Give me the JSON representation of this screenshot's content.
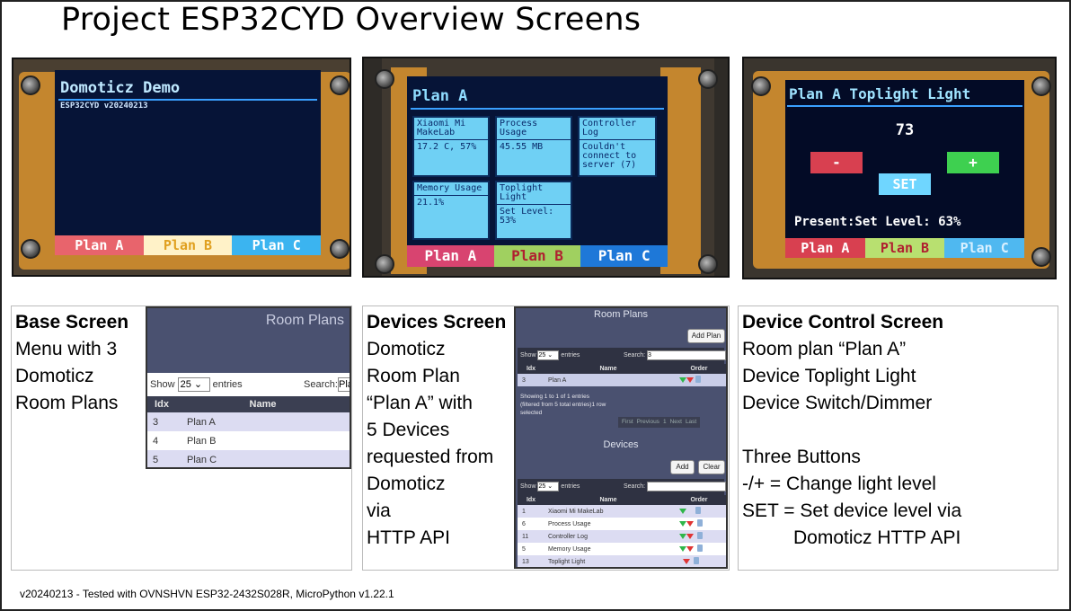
{
  "title": "Project ESP32CYD Overview Screens",
  "photos": {
    "base": {
      "title": "Domoticz Demo",
      "version": "ESP32CYD v20240213",
      "menu": [
        "Plan A",
        "Plan B",
        "Plan C"
      ]
    },
    "devices": {
      "title": "Plan A",
      "tiles": [
        {
          "name": "Xiaomi Mi MakeLab",
          "value": "17.2 C, 57%"
        },
        {
          "name": "Process Usage",
          "value": "45.55 MB"
        },
        {
          "name": "Controller Log",
          "value": "Couldn't connect to server (7)"
        },
        {
          "name": "Memory Usage",
          "value": "21.1%"
        },
        {
          "name": "Toplight Light",
          "value": "Set Level: 53%"
        }
      ],
      "menu": [
        "Plan A",
        "Plan B",
        "Plan C"
      ]
    },
    "control": {
      "title": "Plan A Toplight Light",
      "value": "73",
      "minus": "-",
      "plus": "+",
      "set": "SET",
      "present": "Present:Set Level: 63%",
      "menu": [
        "Plan A",
        "Plan B",
        "Plan C"
      ]
    }
  },
  "colors": {
    "menu_a": "#e8646c",
    "menu_b": "#b8e070",
    "menu_c": "#3bb4f0",
    "lcd_bg": "#061437",
    "tile_bg": "#6fd0f4"
  },
  "base_panel": {
    "heading": "Base Screen",
    "lines": [
      "Menu with 3",
      "Domoticz",
      "Room Plans"
    ]
  },
  "devices_panel": {
    "heading": "Devices Screen",
    "lines": [
      "Domoticz",
      "Room Plan",
      "“Plan A” with",
      "5 Devices",
      "requested from",
      "Domoticz",
      "via",
      "HTTP API"
    ]
  },
  "control_panel": {
    "heading": "Device Control Screen",
    "lines": [
      "Room plan “Plan A”",
      "Device Toplight Light",
      "Device Switch/Dimmer",
      "",
      "Three Buttons",
      "-/+ = Change light level",
      "SET = Set device level via",
      "Domoticz HTTP API"
    ]
  },
  "roomplans_small": {
    "title": "Room Plans",
    "show": "Show",
    "entries_value": "25",
    "entries": "entries",
    "search": "Search:",
    "search_value": "Pla",
    "columns": [
      "Idx",
      "Name"
    ],
    "rows": [
      {
        "idx": "3",
        "name": "Plan A"
      },
      {
        "idx": "4",
        "name": "Plan B"
      },
      {
        "idx": "5",
        "name": "Plan C"
      }
    ]
  },
  "roomplans_large": {
    "title": "Room Plans",
    "add_plan": "Add Plan",
    "show": "Show",
    "entries_value": "25",
    "entries": "entries",
    "search": "Search:",
    "search_value": "3",
    "columns": [
      "Idx",
      "Name",
      "Order"
    ],
    "rows": [
      {
        "idx": "3",
        "name": "Plan A"
      }
    ],
    "info": [
      "Showing 1 to 1 of 1 entries",
      "(filtered from 5 total entries)1 row",
      "selected"
    ],
    "pager": [
      "First",
      "Previous",
      "1",
      "Next",
      "Last"
    ],
    "devices_title": "Devices",
    "add": "Add",
    "clear": "Clear",
    "dev_columns": [
      "Idx",
      "Name",
      "Order"
    ],
    "devices": [
      {
        "idx": "1",
        "name": "Xiaomi Mi MakeLab"
      },
      {
        "idx": "6",
        "name": "Process Usage"
      },
      {
        "idx": "11",
        "name": "Controller Log"
      },
      {
        "idx": "5",
        "name": "Memory Usage"
      },
      {
        "idx": "13",
        "name": "Toplight Light"
      }
    ]
  },
  "footer": "v20240213 - Tested with OVNSHVN ESP32-2432S028R, MicroPython v1.22.1"
}
